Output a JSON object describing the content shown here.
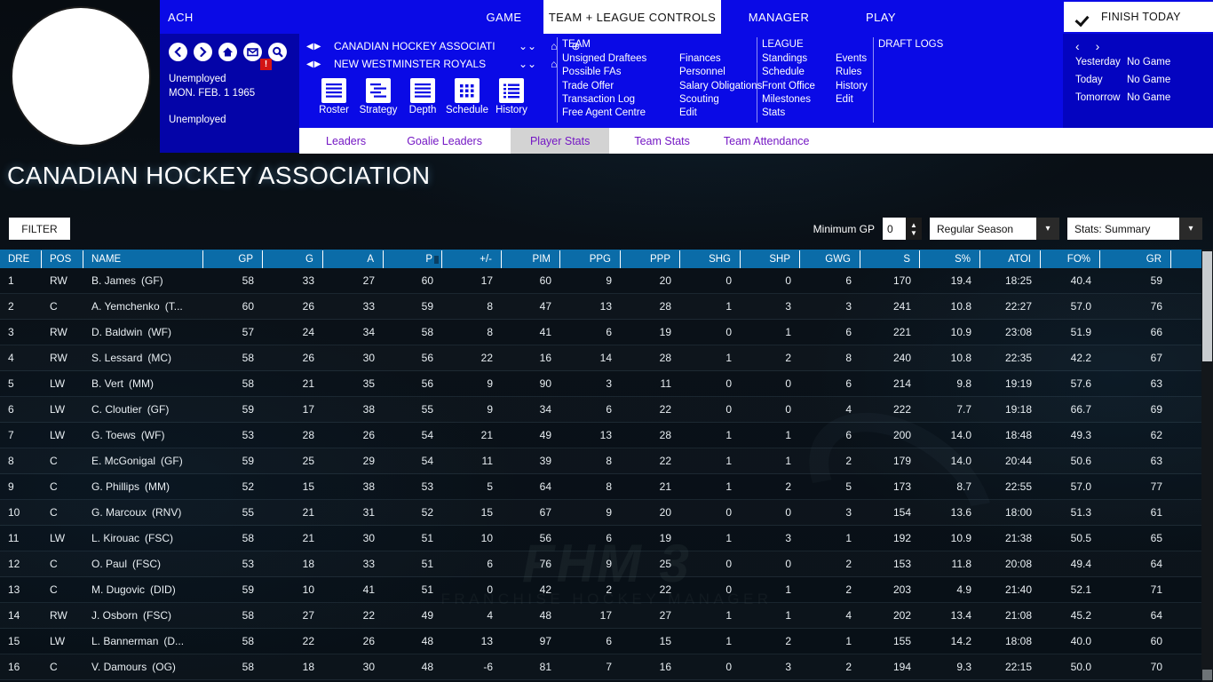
{
  "topbar": {
    "ach": "ACH",
    "game": "GAME",
    "team_league_controls": "TEAM + LEAGUE CONTROLS",
    "manager": "MANAGER",
    "play": "PLAY",
    "finish_today": "FINISH TODAY"
  },
  "left_panel": {
    "status": "Unemployed",
    "date": "MON. FEB. 1 1965",
    "status2": "Unemployed",
    "mail_badge": "!"
  },
  "selectors": {
    "league": "CANADIAN HOCKEY ASSOCIATI",
    "team": "NEW WESTMINSTER ROYALS"
  },
  "big_icons": [
    {
      "label": "Roster",
      "icon": "lines-icon"
    },
    {
      "label": "Strategy",
      "icon": "strategy-icon"
    },
    {
      "label": "Depth",
      "icon": "depth-icon"
    },
    {
      "label": "Schedule",
      "icon": "calendar-icon"
    },
    {
      "label": "History",
      "icon": "list-icon"
    }
  ],
  "menus": {
    "team": {
      "header": "TEAM",
      "col1": [
        "Unsigned Draftees",
        "Possible FAs",
        "Trade Offer",
        "Transaction Log",
        "Free Agent Centre"
      ],
      "col2": [
        "Finances",
        "Personnel",
        "Salary Obligations",
        "Scouting",
        "Edit"
      ]
    },
    "league": {
      "header": "LEAGUE",
      "col1": [
        "Standings",
        "Schedule",
        "Front Office",
        "Milestones",
        "Stats"
      ],
      "col2": [
        "Events",
        "Rules",
        "History",
        "Edit"
      ]
    },
    "draft": {
      "header": "DRAFT LOGS"
    }
  },
  "schedule": {
    "rows": [
      {
        "day": "Yesterday",
        "game": "No Game"
      },
      {
        "day": "Today",
        "game": "No Game"
      },
      {
        "day": "Tomorrow",
        "game": "No Game"
      }
    ]
  },
  "subtabs": [
    {
      "label": "Leaders",
      "active": false
    },
    {
      "label": "Goalie Leaders",
      "active": false
    },
    {
      "label": "Player Stats",
      "active": true
    },
    {
      "label": "Team Stats",
      "active": false
    },
    {
      "label": "Team Attendance",
      "active": false
    }
  ],
  "page_title": "CANADIAN HOCKEY ASSOCIATION",
  "controls": {
    "filter": "FILTER",
    "minimum_gp_label": "Minimum GP",
    "minimum_gp_value": "0",
    "season": "Regular Season",
    "stats_view": "Stats: Summary"
  },
  "table": {
    "columns": [
      "DRE",
      "POS",
      "NAME",
      "GP",
      "G",
      "A",
      "P",
      "+/-",
      "PIM",
      "PPG",
      "PPP",
      "SHG",
      "SHP",
      "GWG",
      "S",
      "S%",
      "ATOI",
      "FO%",
      "GR"
    ],
    "sort_column": "P",
    "rows": [
      {
        "dre": "1",
        "pos": "RW",
        "name": "B. James",
        "team": "(GF)",
        "gp": "58",
        "g": "33",
        "a": "27",
        "p": "60",
        "pm": "17",
        "pim": "60",
        "ppg": "9",
        "ppp": "20",
        "shg": "0",
        "shp": "0",
        "gwg": "6",
        "s": "170",
        "spct": "19.4",
        "atoi": "18:25",
        "fopct": "40.4",
        "gr": "59"
      },
      {
        "dre": "2",
        "pos": "C",
        "name": "A. Yemchenko",
        "team": "(T...",
        "gp": "60",
        "g": "26",
        "a": "33",
        "p": "59",
        "pm": "8",
        "pim": "47",
        "ppg": "13",
        "ppp": "28",
        "shg": "1",
        "shp": "3",
        "gwg": "3",
        "s": "241",
        "spct": "10.8",
        "atoi": "22:27",
        "fopct": "57.0",
        "gr": "76"
      },
      {
        "dre": "3",
        "pos": "RW",
        "name": "D. Baldwin",
        "team": "(WF)",
        "gp": "57",
        "g": "24",
        "a": "34",
        "p": "58",
        "pm": "8",
        "pim": "41",
        "ppg": "6",
        "ppp": "19",
        "shg": "0",
        "shp": "1",
        "gwg": "6",
        "s": "221",
        "spct": "10.9",
        "atoi": "23:08",
        "fopct": "51.9",
        "gr": "66"
      },
      {
        "dre": "4",
        "pos": "RW",
        "name": "S. Lessard",
        "team": "(MC)",
        "gp": "58",
        "g": "26",
        "a": "30",
        "p": "56",
        "pm": "22",
        "pim": "16",
        "ppg": "14",
        "ppp": "28",
        "shg": "1",
        "shp": "2",
        "gwg": "8",
        "s": "240",
        "spct": "10.8",
        "atoi": "22:35",
        "fopct": "42.2",
        "gr": "67"
      },
      {
        "dre": "5",
        "pos": "LW",
        "name": "B. Vert",
        "team": "(MM)",
        "gp": "58",
        "g": "21",
        "a": "35",
        "p": "56",
        "pm": "9",
        "pim": "90",
        "ppg": "3",
        "ppp": "11",
        "shg": "0",
        "shp": "0",
        "gwg": "6",
        "s": "214",
        "spct": "9.8",
        "atoi": "19:19",
        "fopct": "57.6",
        "gr": "63"
      },
      {
        "dre": "6",
        "pos": "LW",
        "name": "C. Cloutier",
        "team": "(GF)",
        "gp": "59",
        "g": "17",
        "a": "38",
        "p": "55",
        "pm": "9",
        "pim": "34",
        "ppg": "6",
        "ppp": "22",
        "shg": "0",
        "shp": "0",
        "gwg": "4",
        "s": "222",
        "spct": "7.7",
        "atoi": "19:18",
        "fopct": "66.7",
        "gr": "69"
      },
      {
        "dre": "7",
        "pos": "LW",
        "name": "G. Toews",
        "team": "(WF)",
        "gp": "53",
        "g": "28",
        "a": "26",
        "p": "54",
        "pm": "21",
        "pim": "49",
        "ppg": "13",
        "ppp": "28",
        "shg": "1",
        "shp": "1",
        "gwg": "6",
        "s": "200",
        "spct": "14.0",
        "atoi": "18:48",
        "fopct": "49.3",
        "gr": "62"
      },
      {
        "dre": "8",
        "pos": "C",
        "name": "E. McGonigal",
        "team": "(GF)",
        "gp": "59",
        "g": "25",
        "a": "29",
        "p": "54",
        "pm": "11",
        "pim": "39",
        "ppg": "8",
        "ppp": "22",
        "shg": "1",
        "shp": "1",
        "gwg": "2",
        "s": "179",
        "spct": "14.0",
        "atoi": "20:44",
        "fopct": "50.6",
        "gr": "63"
      },
      {
        "dre": "9",
        "pos": "C",
        "name": "G. Phillips",
        "team": "(MM)",
        "gp": "52",
        "g": "15",
        "a": "38",
        "p": "53",
        "pm": "5",
        "pim": "64",
        "ppg": "8",
        "ppp": "21",
        "shg": "1",
        "shp": "2",
        "gwg": "5",
        "s": "173",
        "spct": "8.7",
        "atoi": "22:55",
        "fopct": "57.0",
        "gr": "77"
      },
      {
        "dre": "10",
        "pos": "C",
        "name": "G. Marcoux",
        "team": "(RNV)",
        "gp": "55",
        "g": "21",
        "a": "31",
        "p": "52",
        "pm": "15",
        "pim": "67",
        "ppg": "9",
        "ppp": "20",
        "shg": "0",
        "shp": "0",
        "gwg": "3",
        "s": "154",
        "spct": "13.6",
        "atoi": "18:00",
        "fopct": "51.3",
        "gr": "61"
      },
      {
        "dre": "11",
        "pos": "LW",
        "name": "L. Kirouac",
        "team": "(FSC)",
        "gp": "58",
        "g": "21",
        "a": "30",
        "p": "51",
        "pm": "10",
        "pim": "56",
        "ppg": "6",
        "ppp": "19",
        "shg": "1",
        "shp": "3",
        "gwg": "1",
        "s": "192",
        "spct": "10.9",
        "atoi": "21:38",
        "fopct": "50.5",
        "gr": "65"
      },
      {
        "dre": "12",
        "pos": "C",
        "name": "O. Paul",
        "team": "(FSC)",
        "gp": "53",
        "g": "18",
        "a": "33",
        "p": "51",
        "pm": "6",
        "pim": "76",
        "ppg": "9",
        "ppp": "25",
        "shg": "0",
        "shp": "0",
        "gwg": "2",
        "s": "153",
        "spct": "11.8",
        "atoi": "20:08",
        "fopct": "49.4",
        "gr": "64"
      },
      {
        "dre": "13",
        "pos": "C",
        "name": "M. Dugovic",
        "team": "(DID)",
        "gp": "59",
        "g": "10",
        "a": "41",
        "p": "51",
        "pm": "0",
        "pim": "42",
        "ppg": "2",
        "ppp": "22",
        "shg": "0",
        "shp": "1",
        "gwg": "2",
        "s": "203",
        "spct": "4.9",
        "atoi": "21:40",
        "fopct": "52.1",
        "gr": "71"
      },
      {
        "dre": "14",
        "pos": "RW",
        "name": "J. Osborn",
        "team": "(FSC)",
        "gp": "58",
        "g": "27",
        "a": "22",
        "p": "49",
        "pm": "4",
        "pim": "48",
        "ppg": "17",
        "ppp": "27",
        "shg": "1",
        "shp": "1",
        "gwg": "4",
        "s": "202",
        "spct": "13.4",
        "atoi": "21:08",
        "fopct": "45.2",
        "gr": "64"
      },
      {
        "dre": "15",
        "pos": "LW",
        "name": "L. Bannerman",
        "team": "(D...",
        "gp": "58",
        "g": "22",
        "a": "26",
        "p": "48",
        "pm": "13",
        "pim": "97",
        "ppg": "6",
        "ppp": "15",
        "shg": "1",
        "shp": "2",
        "gwg": "1",
        "s": "155",
        "spct": "14.2",
        "atoi": "18:08",
        "fopct": "40.0",
        "gr": "60"
      },
      {
        "dre": "16",
        "pos": "C",
        "name": "V. Damours",
        "team": "(OG)",
        "gp": "58",
        "g": "18",
        "a": "30",
        "p": "48",
        "pm": "-6",
        "pim": "81",
        "ppg": "7",
        "ppp": "16",
        "shg": "0",
        "shp": "3",
        "gwg": "2",
        "s": "194",
        "spct": "9.3",
        "atoi": "22:15",
        "fopct": "50.0",
        "gr": "70"
      }
    ]
  },
  "watermark": {
    "main": "FHM 3",
    "sub": "FRANCHISE HOCKEY MANAGER"
  },
  "colors": {
    "blue_bar": "#0a0ae6",
    "header_blue": "#0b6ca8",
    "tab_purple": "#7417c4",
    "accent_red": "#d31414"
  }
}
